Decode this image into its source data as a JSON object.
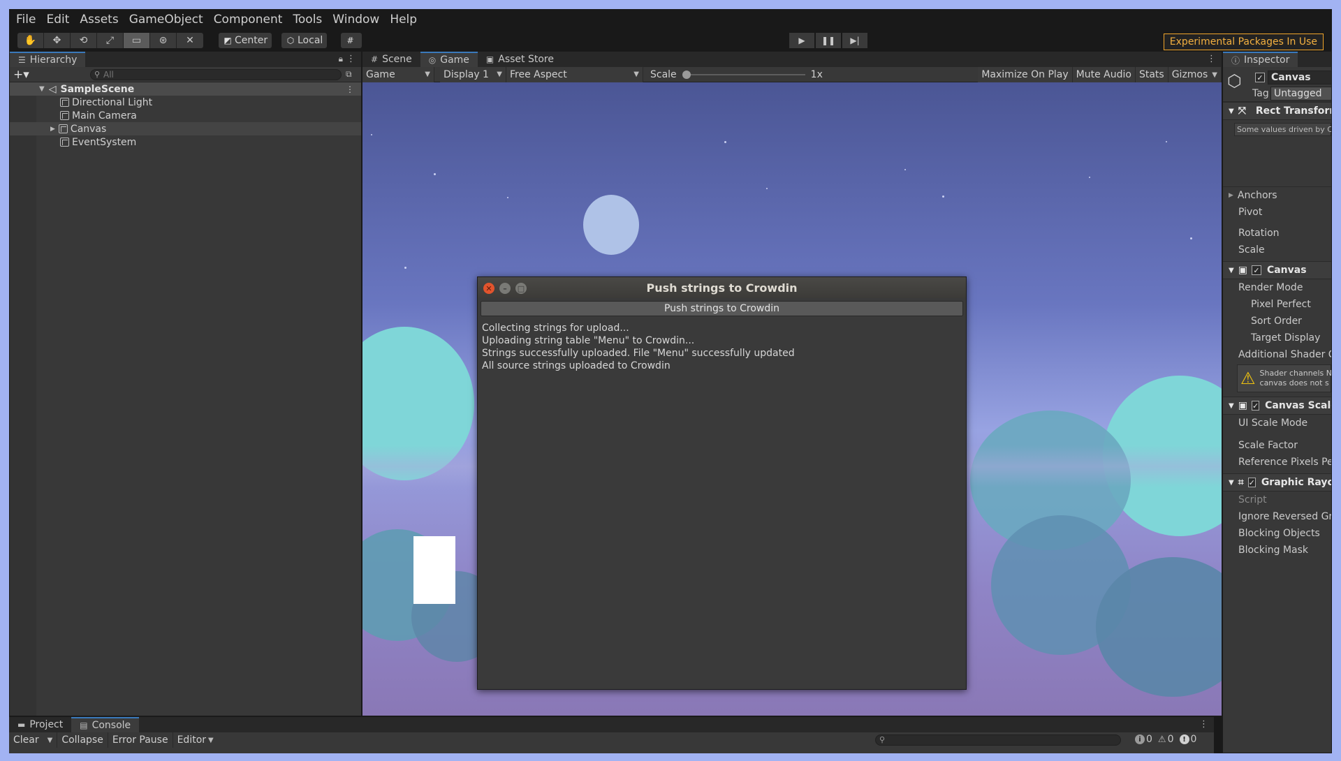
{
  "menubar": {
    "items": [
      "File",
      "Edit",
      "Assets",
      "GameObject",
      "Component",
      "Tools",
      "Window",
      "Help"
    ]
  },
  "toolbar": {
    "center_label": "Center",
    "local_label": "Local",
    "experimental_label": "Experimental Packages In Use"
  },
  "hierarchy": {
    "tab_label": "Hierarchy",
    "search_placeholder": "All",
    "scene_name": "SampleScene",
    "items": [
      "Directional Light",
      "Main Camera",
      "Canvas",
      "EventSystem"
    ]
  },
  "center_tabs": {
    "scene": "Scene",
    "game": "Game",
    "asset_store": "Asset Store"
  },
  "gamebar": {
    "display_mode": "Game",
    "display": "Display 1",
    "aspect": "Free Aspect",
    "scale_label": "Scale",
    "scale_value": "1x",
    "maximize": "Maximize On Play",
    "mute": "Mute Audio",
    "stats": "Stats",
    "gizmos": "Gizmos"
  },
  "dialog": {
    "title": "Push strings to Crowdin",
    "button": "Push strings to Crowdin",
    "log": [
      "Collecting strings for upload...",
      "Uploading string table \"Menu\" to Crowdin...",
      "Strings successfully uploaded. File \"Menu\" successfully updated",
      "All source strings uploaded to Crowdin"
    ]
  },
  "inspector": {
    "tab_label": "Inspector",
    "object_name": "Canvas",
    "tag_label": "Tag",
    "tag_value": "Untagged",
    "rect_transform": "Rect Transform",
    "driven_note": "Some values driven by Ca",
    "anchors": "Anchors",
    "pivot": "Pivot",
    "rotation": "Rotation",
    "scale": "Scale",
    "canvas_header": "Canvas",
    "render_mode": "Render Mode",
    "pixel_perfect": "Pixel Perfect",
    "sort_order": "Sort Order",
    "target_display": "Target Display",
    "additional_shader": "Additional Shader Cha",
    "warning_line1": "Shader channels N",
    "warning_line2": "canvas does not s",
    "canvas_scaler": "Canvas Scaler",
    "ui_scale_mode": "UI Scale Mode",
    "scale_factor": "Scale Factor",
    "reference_pixels": "Reference Pixels Per U",
    "graphic_raycaster": "Graphic Rayca",
    "script": "Script",
    "ignore_reversed": "Ignore Reversed Graph",
    "blocking_objects": "Blocking Objects",
    "blocking_mask": "Blocking Mask"
  },
  "bottom": {
    "project_tab": "Project",
    "console_tab": "Console",
    "clear": "Clear",
    "collapse": "Collapse",
    "error_pause": "Error Pause",
    "editor": "Editor",
    "info_count": "0",
    "warn_count": "0",
    "error_count": "0"
  },
  "colors": {
    "accent": "#3a79bb",
    "warning": "#f1a52a",
    "frame": "#a2b3f3"
  }
}
